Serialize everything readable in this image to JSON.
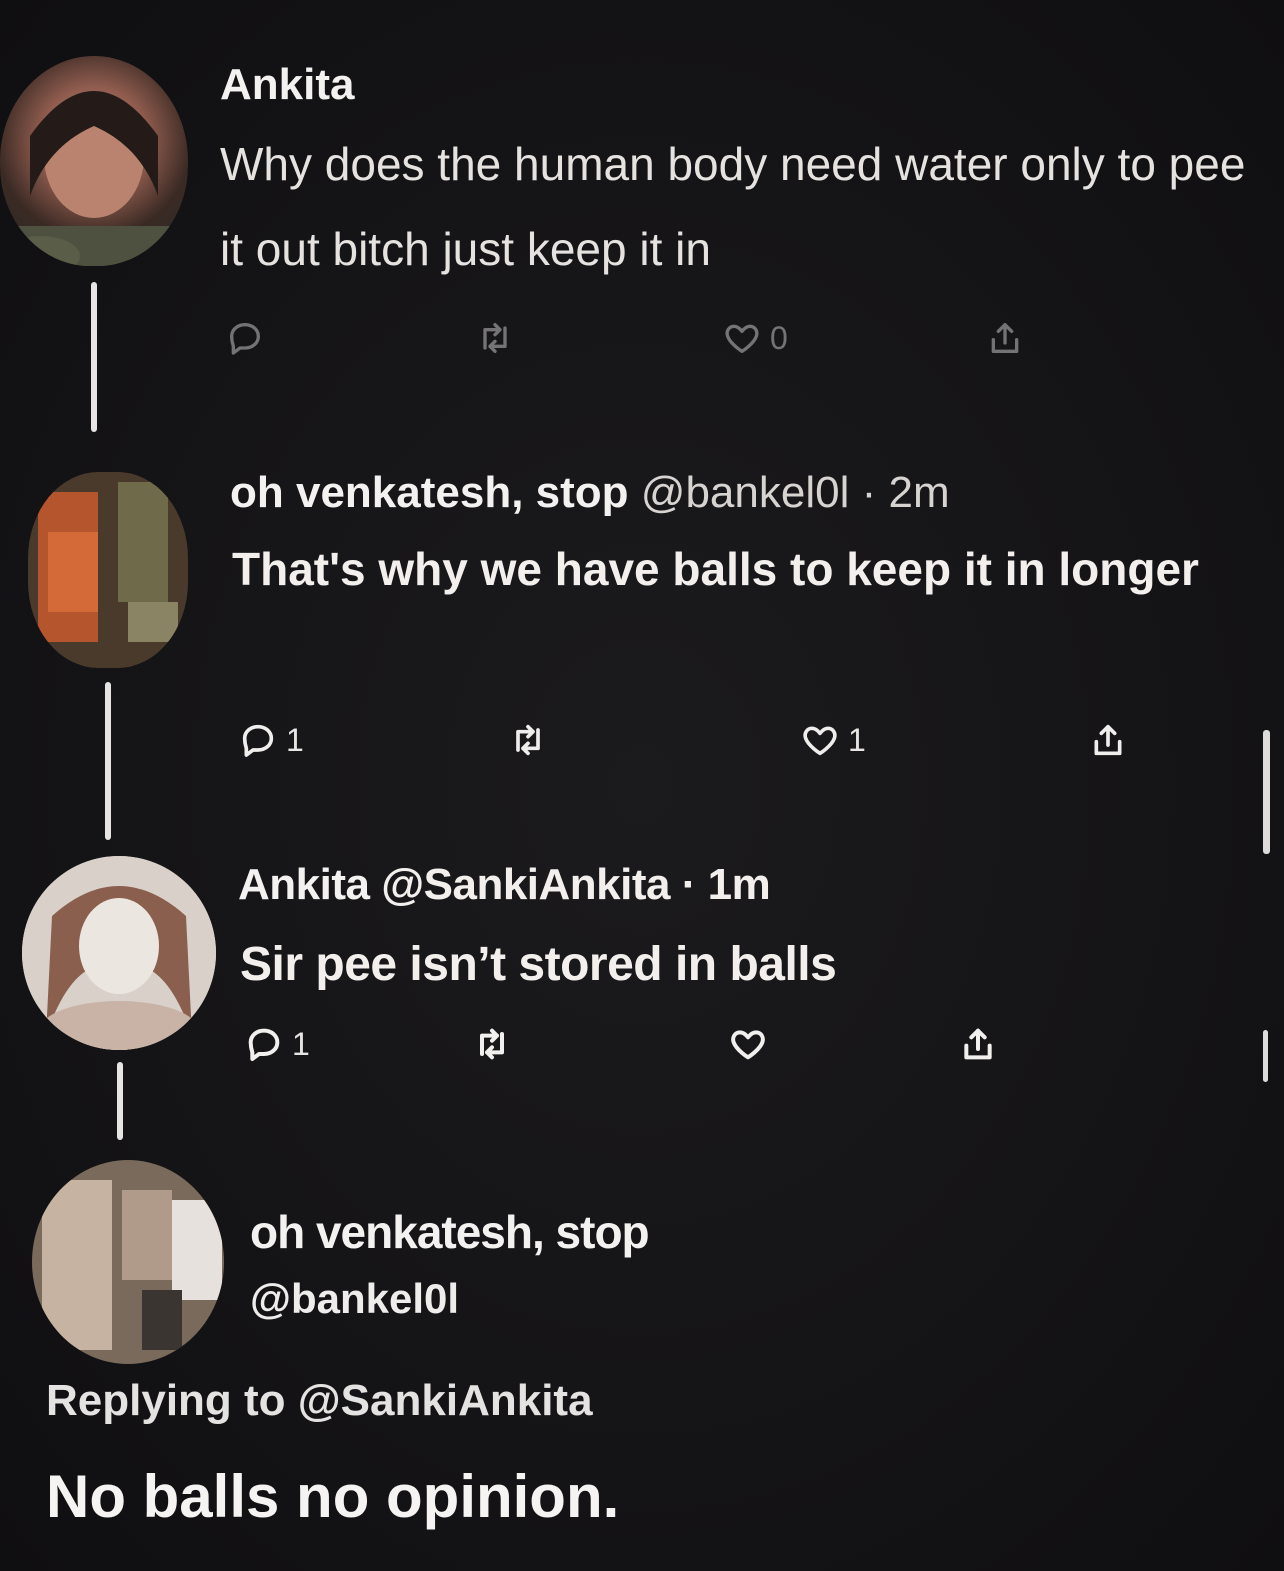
{
  "tweets": [
    {
      "name": "Ankita",
      "text": "Why does the human body need water only to pee it out bitch just keep it in",
      "like_count": "0"
    },
    {
      "name": "oh venkatesh, stop",
      "handle": "@bankel0l",
      "dot": "·",
      "time": "2m",
      "text": "That's why we have balls to keep it in longer",
      "reply_count": "1",
      "like_count": "1"
    },
    {
      "name": "Ankita",
      "handle": "@SankiAnkita",
      "dot": "·",
      "time": "1m",
      "text": "Sir pee isn’t stored in balls",
      "reply_count": "1"
    },
    {
      "name": "oh venkatesh, stop",
      "handle": "@bankel0l",
      "replying_to": "Replying to @SankiAnkita",
      "text": "No balls no opinion."
    }
  ],
  "icons": {
    "reply": "reply-icon",
    "retweet": "retweet-icon",
    "like": "heart-icon",
    "share": "share-icon"
  },
  "colors": {
    "background": "#151416",
    "text": "#f1efee",
    "thread_line": "#e7e5e3"
  }
}
